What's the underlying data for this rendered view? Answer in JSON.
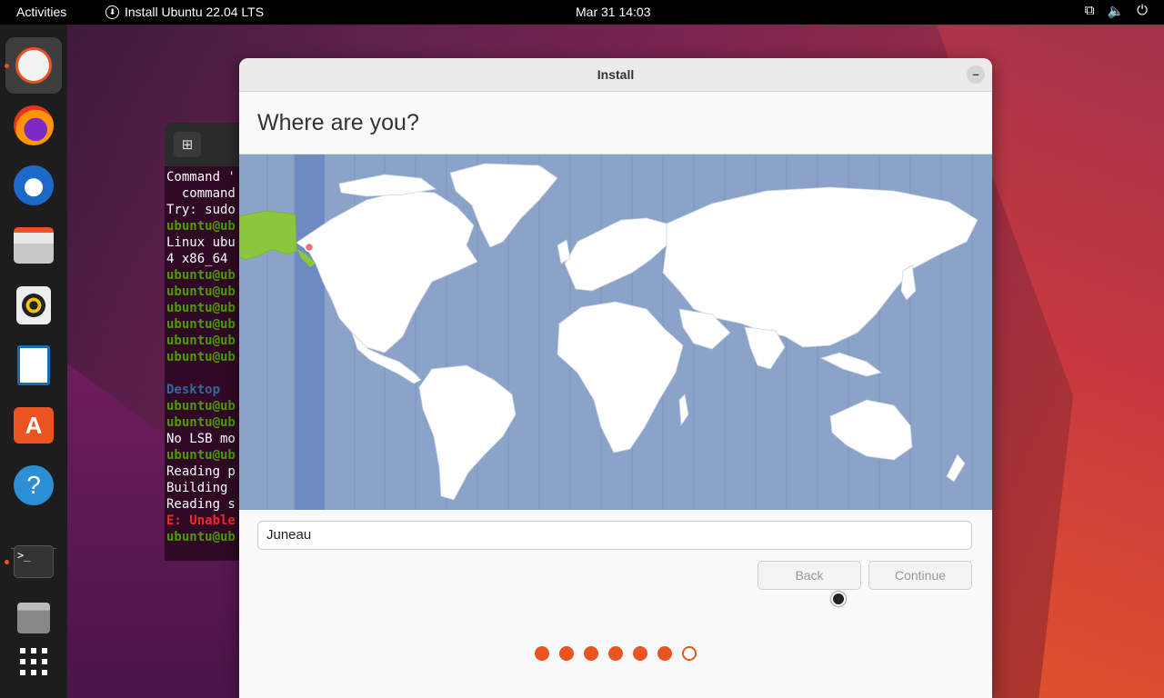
{
  "topbar": {
    "activities": "Activities",
    "app_name": "Install Ubuntu 22.04 LTS",
    "datetime": "Mar 31  14:03",
    "tray_icons": [
      "network-icon",
      "volume-icon",
      "power-icon"
    ]
  },
  "dock": {
    "items": [
      {
        "name": "ubuntu-installer",
        "active": true,
        "running": true
      },
      {
        "name": "firefox",
        "active": false,
        "running": false
      },
      {
        "name": "thunderbird",
        "active": false,
        "running": false
      },
      {
        "name": "files",
        "active": false,
        "running": false
      },
      {
        "name": "rhythmbox",
        "active": false,
        "running": false
      },
      {
        "name": "libreoffice-writer",
        "active": false,
        "running": false
      },
      {
        "name": "app-center",
        "active": false,
        "running": false
      },
      {
        "name": "help",
        "active": false,
        "running": false
      },
      {
        "name": "terminal",
        "active": false,
        "running": true
      },
      {
        "name": "trash",
        "active": false,
        "running": false
      },
      {
        "name": "show-apps",
        "active": false,
        "running": false
      }
    ]
  },
  "terminal": {
    "lines": [
      {
        "text": "Command '",
        "cls": ""
      },
      {
        "text": "  command",
        "cls": ""
      },
      {
        "text": "Try: sudo",
        "cls": ""
      },
      {
        "text": "ubuntu@ub",
        "cls": "g"
      },
      {
        "text": "Linux ubu",
        "cls": ""
      },
      {
        "text": "4 x86_64 ",
        "cls": ""
      },
      {
        "text": "ubuntu@ub",
        "cls": "g"
      },
      {
        "text": "ubuntu@ub",
        "cls": "g"
      },
      {
        "text": "ubuntu@ub",
        "cls": "g"
      },
      {
        "text": "ubuntu@ub",
        "cls": "g"
      },
      {
        "text": "ubuntu@ub",
        "cls": "g"
      },
      {
        "text": "ubuntu@ub",
        "cls": "g"
      },
      {
        "text": "",
        "cls": ""
      },
      {
        "text": "Desktop  ",
        "cls": "b"
      },
      {
        "text": "ubuntu@ub",
        "cls": "g"
      },
      {
        "text": "ubuntu@ub",
        "cls": "g"
      },
      {
        "text": "No LSB mo",
        "cls": ""
      },
      {
        "text": "ubuntu@ub",
        "cls": "g"
      },
      {
        "text": "Reading p",
        "cls": ""
      },
      {
        "text": "Building ",
        "cls": ""
      },
      {
        "text": "Reading s",
        "cls": ""
      },
      {
        "text": "E: Unable",
        "cls": "r"
      },
      {
        "text": "ubuntu@ub",
        "cls": "g"
      }
    ]
  },
  "installer": {
    "window_title": "Install",
    "minimize": "–",
    "heading": "Where are you?",
    "timezone_value": "Juneau",
    "back_label": "Back",
    "continue_label": "Continue",
    "progress": {
      "total": 7,
      "completed": 6
    }
  },
  "colors": {
    "accent": "#e95420",
    "map_water": "#8ca3c9",
    "map_land": "#ffffff",
    "map_selected_region": "#8cc63f",
    "selected_tz_band": "#6d8bc0"
  }
}
